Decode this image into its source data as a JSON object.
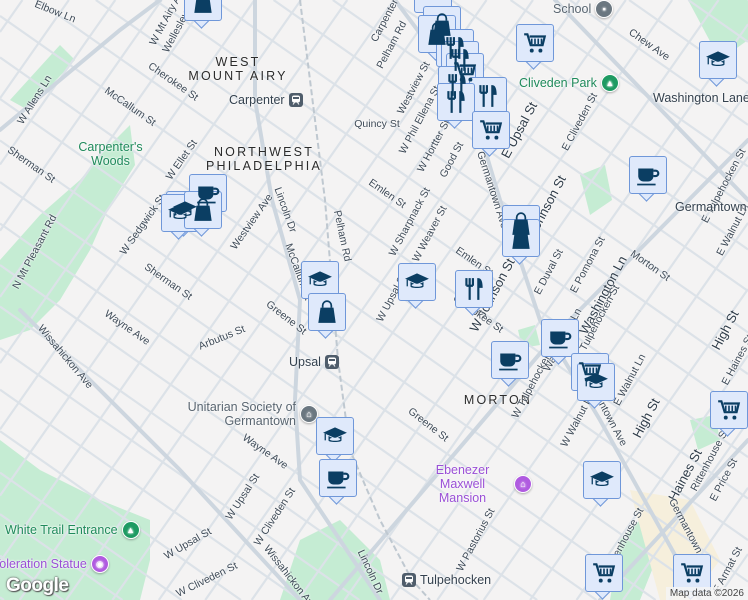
{
  "areas": [
    {
      "lines": [
        "WEST",
        "MOUNT AIRY"
      ]
    },
    {
      "lines": [
        "NORTHWEST",
        "PHILADELPHIA"
      ]
    },
    {
      "lines": [
        "MORTON"
      ]
    }
  ],
  "streets": [
    "Elbow Ln",
    "W Allens Ln",
    "Cherokee St",
    "McCallum St",
    "W Ellet St",
    "Sherman St",
    "N Mt Pleasant Rd",
    "W Sedgwick St",
    "Sherman St",
    "Westview Ave",
    "Lincoln Dr",
    "McCallum St",
    "Pelham Rd",
    "Wayne Ave",
    "Arbutus St",
    "Greene St",
    "Wissahickon Ave",
    "Wayne Ave",
    "W Upsal St",
    "W Cliveden St",
    "W Upsal St",
    "W Cliveden St",
    "Wissahickon Ave",
    "Lincoln Dr",
    "Carpenter St",
    "Pelham Rd",
    "Westview St",
    "W Phil Ellena St",
    "Quincy St",
    "W Hortter St",
    "Good St",
    "Germantown Ave",
    "E Upsal St",
    "E Cliveden St",
    "Chew Ave",
    "Emlen St",
    "W Sharpnack St",
    "W Weaver St",
    "Emlen St",
    "Johnson St",
    "W Johnson St",
    "E Duval St",
    "E Pomona St",
    "Washington Ln",
    "Morton St",
    "E Tulpehocken St",
    "E Walnut Ln",
    "W Upsal St",
    "Cherokee St",
    "W Tulpehocken St",
    "Tulpehocken St",
    "E Walnut Ln",
    "W Walnut Ln",
    "Germantown Ave",
    "High St",
    "High St",
    "Haines St",
    "Greene St",
    "W Pastorius St",
    "W Rittenhouse St",
    "Rittenhouse St",
    "E Price St",
    "E Haines St",
    "Germantown Ave",
    "Washington Ln",
    "W Mt Airy Ave",
    "Wellesley Rd",
    "E Armat St"
  ],
  "pois": [
    {
      "name": "Carpenter",
      "kind": "transit"
    },
    {
      "name": "Upsal",
      "kind": "transit"
    },
    {
      "name": "Tulpehocken",
      "kind": "transit"
    },
    {
      "name": "Carpenter's Woods",
      "kind": "park"
    },
    {
      "name": "Cliveden Park",
      "kind": "park"
    },
    {
      "name": "White Trail Entrance",
      "kind": "park"
    },
    {
      "name": "Unitarian Society of Germantown",
      "kind": "worship"
    },
    {
      "name": "Ebenezer Maxwell Mansion",
      "kind": "historic"
    },
    {
      "name": "Toleration Statue",
      "kind": "attraction"
    },
    {
      "name": "Washington Lane",
      "kind": "transit-label"
    },
    {
      "name": "Germantown",
      "kind": "transit-label"
    },
    {
      "name": "School",
      "kind": "school"
    }
  ],
  "markers": [
    "shopping-bag",
    "school",
    "shopping-bag",
    "shopping-bag",
    "restaurant",
    "restaurant",
    "shopping-cart",
    "restaurant",
    "restaurant",
    "restaurant",
    "shopping-cart",
    "shopping-cart",
    "school",
    "coffee",
    "school",
    "coffee",
    "school",
    "shopping-bag",
    "school",
    "shopping-bag",
    "shopping-bag",
    "shopping-bag",
    "school",
    "restaurant",
    "coffee",
    "coffee",
    "shopping-cart",
    "school",
    "shopping-cart",
    "school",
    "school",
    "coffee",
    "shopping-cart",
    "shopping-cart"
  ],
  "colors": {
    "marker_fill": "#dfe9fb",
    "marker_border": "#6f97d9",
    "marker_icon": "#0b3e63",
    "park": "#c5ecd3",
    "road": "#d3dbe3"
  },
  "footer": {
    "logo": "Google",
    "attribution": "Map data ©2026"
  }
}
